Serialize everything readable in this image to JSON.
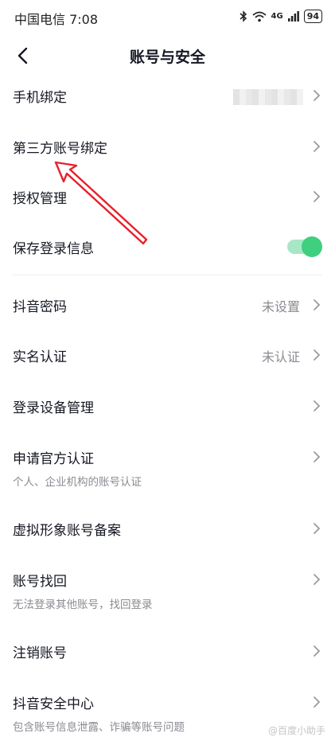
{
  "status_bar": {
    "carrier_time": "中国电信 7:08",
    "signal": "4G",
    "battery": "94"
  },
  "nav": {
    "title": "账号与安全"
  },
  "rows": [
    {
      "label": "手机绑定"
    },
    {
      "label": "第三方账号绑定"
    },
    {
      "label": "授权管理"
    },
    {
      "label": "保存登录信息",
      "toggle_on": true
    },
    {
      "label": "抖音密码",
      "value": "未设置"
    },
    {
      "label": "实名认证",
      "value": "未认证"
    },
    {
      "label": "登录设备管理"
    },
    {
      "label": "申请官方认证",
      "sub": "个人、企业机构的账号认证"
    },
    {
      "label": "虚拟形象账号备案"
    },
    {
      "label": "账号找回",
      "sub": "无法登录其他账号，找回登录"
    },
    {
      "label": "注销账号"
    },
    {
      "label": "抖音安全中心",
      "sub": "包含账号信息泄露、诈骗等账号问题"
    }
  ],
  "colors": {
    "toggle_on": "#3ecf7f",
    "annotation_arrow": "#e8202a"
  },
  "watermark": "@百度小助手"
}
